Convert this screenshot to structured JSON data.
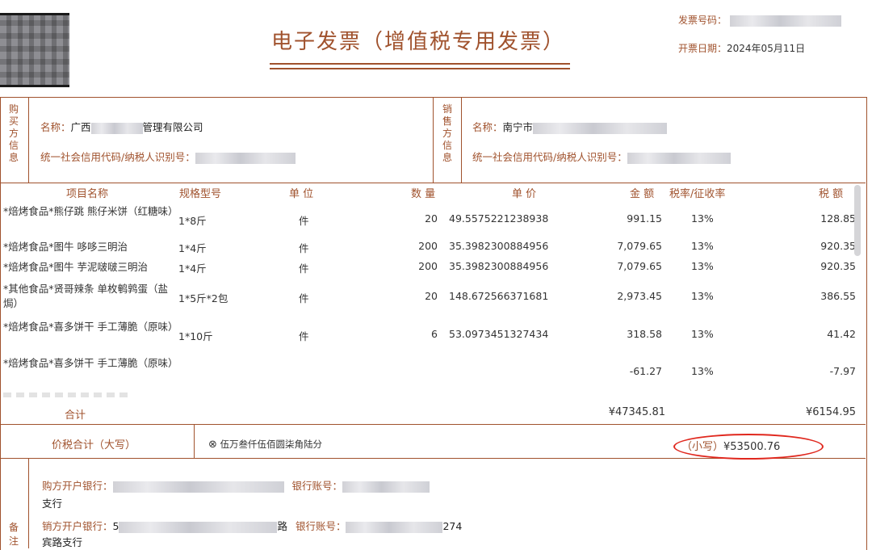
{
  "header": {
    "title": "电子发票（增值税专用发票）",
    "invoice_no_label": "发票号码：",
    "issue_date_label": "开票日期：",
    "issue_date": "2024年05月11日"
  },
  "buyer": {
    "side_label": [
      "购",
      "买",
      "方",
      "信",
      "息"
    ],
    "name_label": "名称：",
    "name_prefix": "广西",
    "name_suffix": "管理有限公司",
    "credit_label": "统一社会信用代码/纳税人识别号："
  },
  "seller": {
    "side_label": [
      "销",
      "售",
      "方",
      "信",
      "息"
    ],
    "name_label": "名称：",
    "name_prefix": "南宁市",
    "credit_label": "统一社会信用代码/纳税人识别号："
  },
  "columns": {
    "name": "项目名称",
    "spec": "规格型号",
    "unit": "单 位",
    "qty": "数 量",
    "price": "单 价",
    "amount": "金 额",
    "rate": "税率/征收率",
    "tax": "税 额"
  },
  "items": [
    {
      "name": "*焙烤食品*熊仔跳 熊仔米饼（红糖味）",
      "spec": "1*8斤",
      "unit": "件",
      "qty": "20",
      "price": "49.5575221238938",
      "amount": "991.15",
      "rate": "13%",
      "tax": "128.85"
    },
    {
      "name": "*焙烤食品*图牛 哆哆三明治",
      "spec": "1*4斤",
      "unit": "件",
      "qty": "200",
      "price": "35.3982300884956",
      "amount": "7,079.65",
      "rate": "13%",
      "tax": "920.35"
    },
    {
      "name": "*焙烤食品*图牛 芋泥啵啵三明治",
      "spec": "1*4斤",
      "unit": "件",
      "qty": "200",
      "price": "35.3982300884956",
      "amount": "7,079.65",
      "rate": "13%",
      "tax": "920.35"
    },
    {
      "name": "*其他食品*贤哥辣条 单枚鹌鹑蛋（盐焗）",
      "spec": "1*5斤*2包",
      "unit": "件",
      "qty": "20",
      "price": "148.672566371681",
      "amount": "2,973.45",
      "rate": "13%",
      "tax": "386.55"
    },
    {
      "name": "*焙烤食品*喜多饼干 手工薄脆（原味）",
      "spec": "1*10斤",
      "unit": "件",
      "qty": "6",
      "price": "53.0973451327434",
      "amount": "318.58",
      "rate": "13%",
      "tax": "41.42"
    },
    {
      "name": "*焙烤食品*喜多饼干 手工薄脆（原味）",
      "spec": "",
      "unit": "",
      "qty": "",
      "price": "",
      "amount": "-61.27",
      "rate": "13%",
      "tax": "-7.97"
    }
  ],
  "totals": {
    "label": "合计",
    "amount": "¥47345.81",
    "tax": "¥6154.95"
  },
  "grand_total": {
    "label": "价税合计（大写）",
    "words_symbol": "⊗",
    "words": "伍万叁仟伍佰圆柒角陆分",
    "small_label": "（小写）",
    "small_value": "¥53500.76"
  },
  "remarks": {
    "side_label": [
      "备",
      "注"
    ],
    "buyer_bank_label": "购方开户银行：",
    "buyer_bank_suffix": "支行",
    "account_label": "银行账号：",
    "seller_bank_label": "销方开户银行：",
    "seller_bank_prefix": "5",
    "seller_bank_mid": "路",
    "seller_account_suffix": "274",
    "seller_bank_suffix": "宾路支行"
  },
  "colors": {
    "accent": "#a0522d",
    "highlight_circle": "#e0281e"
  }
}
